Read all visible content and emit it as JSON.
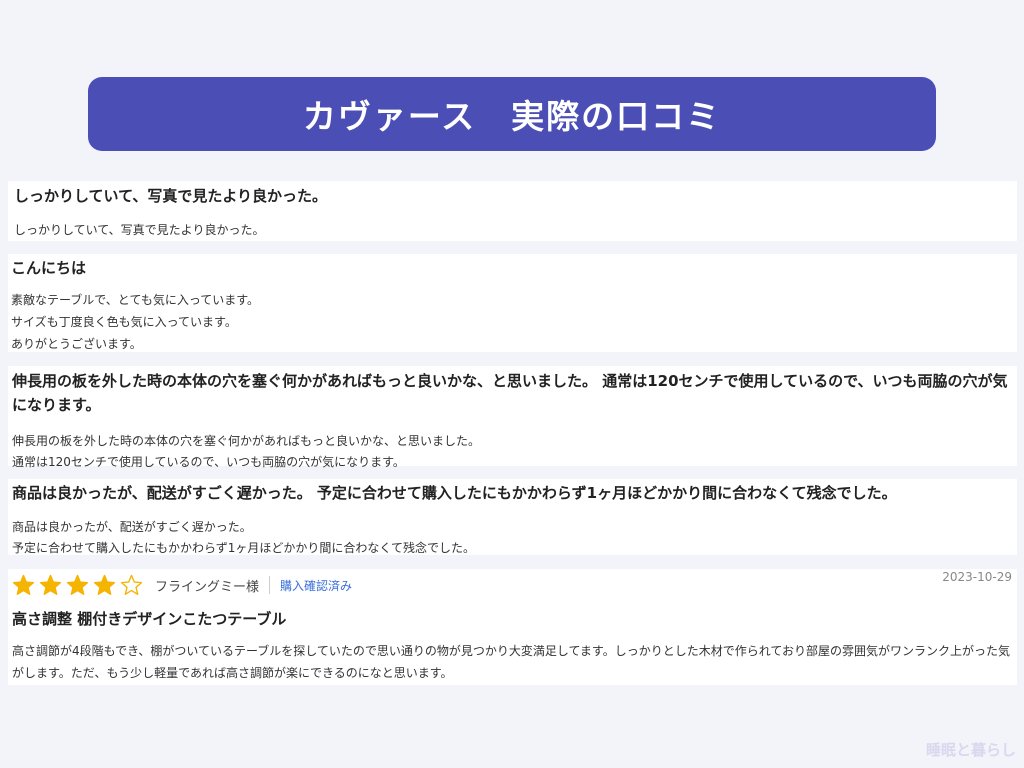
{
  "banner": {
    "title": "カヴァース　実際の口コミ"
  },
  "reviews": [
    {
      "title": "しっかりしていて、写真で見たより良かった。",
      "lines": [
        "しっかりしていて、写真で見たより良かった。"
      ]
    },
    {
      "title": "こんにちは",
      "lines": [
        "素敵なテーブルで、とても気に入っています。",
        "サイズも丁度良く色も気に入っています。",
        "ありがとうございます。"
      ]
    },
    {
      "title": "伸長用の板を外した時の本体の穴を塞ぐ何かがあればもっと良いかな、と思いました。 通常は120センチで使用しているので、いつも両脇の穴が気になります。",
      "lines": [
        "伸長用の板を外した時の本体の穴を塞ぐ何かがあればもっと良いかな、と思いました。",
        "通常は120センチで使用しているので、いつも両脇の穴が気になります。"
      ]
    },
    {
      "title": "商品は良かったが、配送がすごく遅かった。 予定に合わせて購入したにもかかわらず1ヶ月ほどかかり間に合わなくて残念でした。",
      "lines": [
        "商品は良かったが、配送がすごく遅かった。",
        "予定に合わせて購入したにもかかわらず1ヶ月ほどかかり間に合わなくて残念でした。"
      ]
    },
    {
      "rating": 4,
      "rating_max": 5,
      "star_color": "#f5b400",
      "reviewer": "フライングミー様",
      "verified": "購入確認済み",
      "date": "2023-10-29",
      "title": "高さ調整 棚付きデザインこたつテーブル",
      "body": "高さ調節が4段階もでき、棚がついているテーブルを探していたので思い通りの物が見つかり大変満足してます。しっかりとした木材で作られており部屋の雰囲気がワンランク上がった気がします。ただ、もう少し軽量であれば高さ調節が楽にできるのになと思います。"
    }
  ],
  "watermark": "睡眠と暮らし"
}
